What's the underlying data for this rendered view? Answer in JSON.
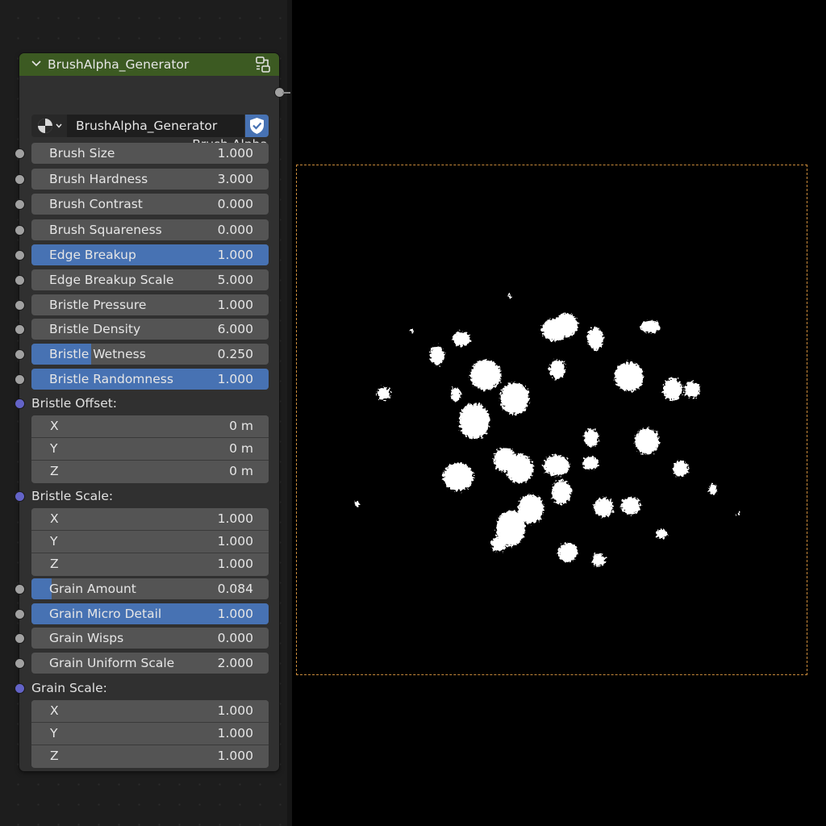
{
  "node": {
    "title": "BrushAlpha_Generator",
    "output_label": "Brush Alpha",
    "group_name": "BrushAlpha_Generator"
  },
  "colors": {
    "header": "#3c5a22",
    "accent": "#4772b3",
    "field": "#545454",
    "vector_socket": "#6363c7",
    "float_socket": "#a1a1a1",
    "preview_border": "#c98a3a"
  },
  "icons": {
    "collapse": "chevron-down-icon",
    "node_type": "node-tree-icon",
    "browse": "sphere-icon",
    "fake_user": "shield-check-icon"
  },
  "inputs": [
    {
      "label": "Brush Size",
      "value": "1.000",
      "fill": 0
    },
    {
      "label": "Brush Hardness",
      "value": "3.000",
      "fill": 0
    },
    {
      "label": "Brush Contrast",
      "value": "0.000",
      "fill": 0
    },
    {
      "label": "Brush Squareness",
      "value": "0.000",
      "fill": 0
    },
    {
      "label": "Edge Breakup",
      "value": "1.000",
      "fill": 1
    },
    {
      "label": "Edge Breakup Scale",
      "value": "5.000",
      "fill": 0
    },
    {
      "label": "Bristle Pressure",
      "value": "1.000",
      "fill": 0
    },
    {
      "label": "Bristle Density",
      "value": "6.000",
      "fill": 0
    },
    {
      "label": "Bristle Wetness",
      "value": "0.250",
      "fill": 0.25
    },
    {
      "label": "Bristle Randomness",
      "value": "1.000",
      "fill": 1
    }
  ],
  "bristle_offset": {
    "label": "Bristle Offset:",
    "rows": [
      {
        "axis": "X",
        "value": "0 m"
      },
      {
        "axis": "Y",
        "value": "0 m"
      },
      {
        "axis": "Z",
        "value": "0 m"
      }
    ]
  },
  "bristle_scale": {
    "label": "Bristle Scale:",
    "rows": [
      {
        "axis": "X",
        "value": "1.000"
      },
      {
        "axis": "Y",
        "value": "1.000"
      },
      {
        "axis": "Z",
        "value": "1.000"
      }
    ]
  },
  "grain_inputs": [
    {
      "label": "Grain Amount",
      "value": "0.084",
      "fill": 0.084
    },
    {
      "label": "Grain Micro Detail",
      "value": "1.000",
      "fill": 1
    },
    {
      "label": "Grain Wisps",
      "value": "0.000",
      "fill": 0
    },
    {
      "label": "Grain Uniform Scale",
      "value": "2.000",
      "fill": 0
    }
  ],
  "grain_scale": {
    "label": "Grain Scale:",
    "rows": [
      {
        "axis": "X",
        "value": "1.000"
      },
      {
        "axis": "Y",
        "value": "1.000"
      },
      {
        "axis": "Z",
        "value": "1.000"
      }
    ]
  }
}
